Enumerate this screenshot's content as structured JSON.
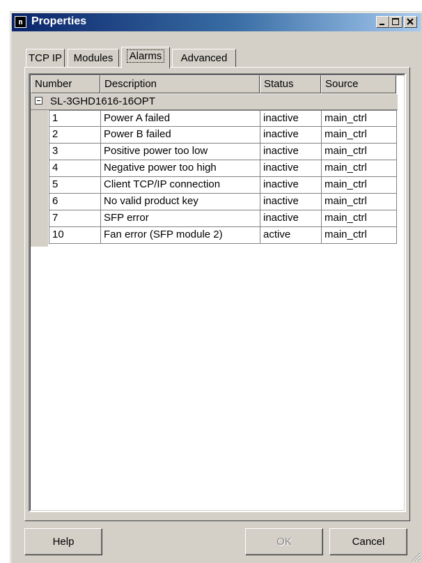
{
  "window": {
    "title": "Properties"
  },
  "tabs": [
    {
      "label": "TCP IP"
    },
    {
      "label": "Modules"
    },
    {
      "label": "Alarms"
    },
    {
      "label": "Advanced"
    }
  ],
  "active_tab": "Alarms",
  "table": {
    "columns": [
      "Number",
      "Description",
      "Status",
      "Source"
    ],
    "group": "SL-3GHD1616-16OPT",
    "rows": [
      {
        "number": "1",
        "description": "Power A failed",
        "status": "inactive",
        "source": "main_ctrl"
      },
      {
        "number": "2",
        "description": "Power B failed",
        "status": "inactive",
        "source": "main_ctrl"
      },
      {
        "number": "3",
        "description": "Positive power too low",
        "status": "inactive",
        "source": "main_ctrl"
      },
      {
        "number": "4",
        "description": "Negative power too high",
        "status": "inactive",
        "source": "main_ctrl"
      },
      {
        "number": "5",
        "description": "Client TCP/IP connection",
        "status": "inactive",
        "source": "main_ctrl"
      },
      {
        "number": "6",
        "description": "No valid product key",
        "status": "inactive",
        "source": "main_ctrl"
      },
      {
        "number": "7",
        "description": "SFP error",
        "status": "inactive",
        "source": "main_ctrl"
      },
      {
        "number": "10",
        "description": "Fan error (SFP module 2)",
        "status": "active",
        "source": "main_ctrl"
      }
    ]
  },
  "buttons": {
    "help": "Help",
    "ok": "OK",
    "cancel": "Cancel"
  },
  "icons": {
    "app": "app-icon",
    "minimize": "minimize-icon",
    "maximize": "maximize-icon",
    "close": "close-icon",
    "collapse": "collapse-icon",
    "grip": "resize-grip-icon"
  },
  "colors": {
    "titlebar_start": "#0a246a",
    "titlebar_end": "#a6caf0",
    "face": "#d4d0c8"
  }
}
